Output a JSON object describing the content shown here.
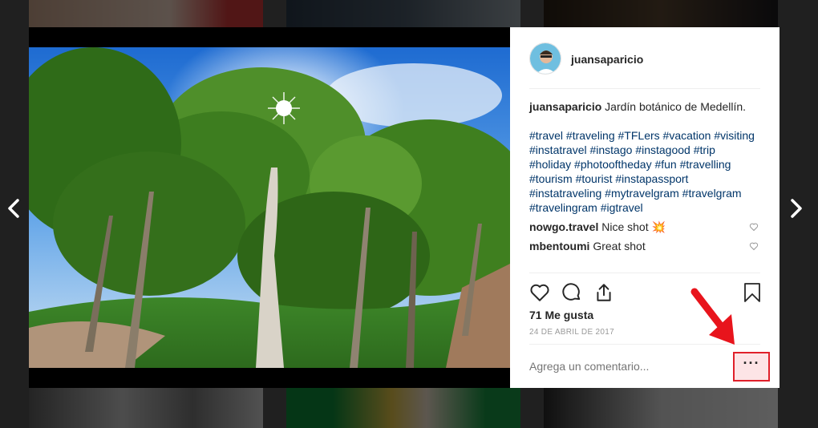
{
  "post": {
    "username": "juansaparicio",
    "caption_user": "juansaparicio",
    "caption_text": " Jardín botánico de Medellín.",
    "hashtags": [
      "#travel",
      "#traveling",
      "#TFLers",
      "#vacation",
      "#visiting",
      "#instatravel",
      "#instago",
      "#instagood",
      "#trip",
      "#holiday",
      "#photooftheday",
      "#fun",
      "#travelling",
      "#tourism",
      "#tourist",
      "#instapassport",
      "#instatraveling",
      "#mytravelgram",
      "#travelgram",
      "#travelingram",
      "#igtravel"
    ],
    "comments": [
      {
        "user": "nowgo.travel",
        "text": " Nice shot 💥"
      },
      {
        "user": "mbentoumi",
        "text": " Great shot"
      }
    ],
    "likes": "71 Me gusta",
    "date": "24 DE ABRIL DE 2017",
    "comment_placeholder": "Agrega un comentario...",
    "more_label": "···"
  },
  "icons": {
    "like": "heart-icon",
    "comment": "comment-bubble-icon",
    "share": "share-icon",
    "save": "bookmark-icon",
    "prev": "chevron-left-icon",
    "next": "chevron-right-icon"
  },
  "colors": {
    "hashtag": "#003569",
    "highlight_border": "#e0202a",
    "highlight_fill": "#fde4e6",
    "annotation_arrow": "#e8141c"
  }
}
